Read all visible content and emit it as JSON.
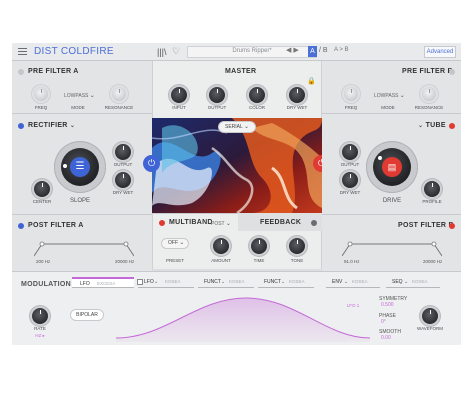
{
  "header": {
    "title": "DIST COLDFIRE",
    "preset_name": "Drums Ripper*",
    "prev_next": "◀ ▶",
    "ab_a": "A",
    "ab_b": "/ B",
    "ab_copy": "A > B",
    "advanced_label": "Advanced"
  },
  "pre_filter_a": {
    "title": "PRE FILTER A",
    "freq_label": "FREQ",
    "mode_label": "MODE",
    "mode_value": "LOWPASS",
    "resonance_label": "RESONANCE"
  },
  "pre_filter_b": {
    "title": "PRE FILTER B",
    "freq_label": "FREQ",
    "mode_label": "MODE",
    "mode_value": "LOWPASS",
    "resonance_label": "RESONANCE"
  },
  "master": {
    "title": "MASTER",
    "knobs": [
      "INPUT",
      "OUTPUT",
      "COLOR",
      "DRY WET"
    ]
  },
  "rectifier": {
    "title": "RECTIFIER",
    "output_label": "OUTPUT",
    "drywet_label": "DRY WET",
    "center_label": "CENTER",
    "slope_label": "SLOPE"
  },
  "tube": {
    "title": "TUBE",
    "output_label": "OUTPUT",
    "drywet_label": "DRY WET",
    "profile_label": "PROFILE",
    "drive_label": "DRIVE"
  },
  "routing": {
    "mode_value": "SERIAL"
  },
  "post_filter_a": {
    "title": "POST FILTER A",
    "freq_low": "200 Hz",
    "freq_high": "20000 Hz"
  },
  "post_filter_b": {
    "title": "POST FILTER B",
    "freq_low": "91.0 Hz",
    "freq_high": "20000 Hz"
  },
  "multiband": {
    "title": "MULTIBAND",
    "post_label": "POST"
  },
  "feedback": {
    "title": "FEEDBACK",
    "preset_value": "OFF",
    "preset_label": "PRESET",
    "amount_label": "AMOUNT",
    "time_label": "TIME",
    "tone_label": "TONE"
  },
  "modulation": {
    "title": "MODULATION",
    "tabs": [
      {
        "label": "LFO",
        "name": "EXCESA"
      },
      {
        "label": "LFO",
        "name": "KOSEA"
      },
      {
        "label": "FUNCT",
        "name": "KOSEA"
      },
      {
        "label": "FUNCT",
        "name": "KOSEA"
      },
      {
        "label": "ENV",
        "name": "KOSEA"
      },
      {
        "label": "SEQ",
        "name": "KOSEA"
      }
    ],
    "rate_label": "RATE",
    "rate_value": "HZ ▸",
    "bipolar_label": "BIPOLAR",
    "lfo_label": "LFO 1",
    "symmetry_label": "SYMMETRY",
    "symmetry_value": "0.500",
    "phase_label": "PHASE",
    "phase_value": "0°",
    "smooth_label": "SMOOTH",
    "smooth_value": "0.00",
    "waveform_label": "WAVEFORM"
  },
  "colors": {
    "accent_blue": "#4c6fd8",
    "accent_red": "#e03a33",
    "lfo_pink": "#c46ad8"
  }
}
